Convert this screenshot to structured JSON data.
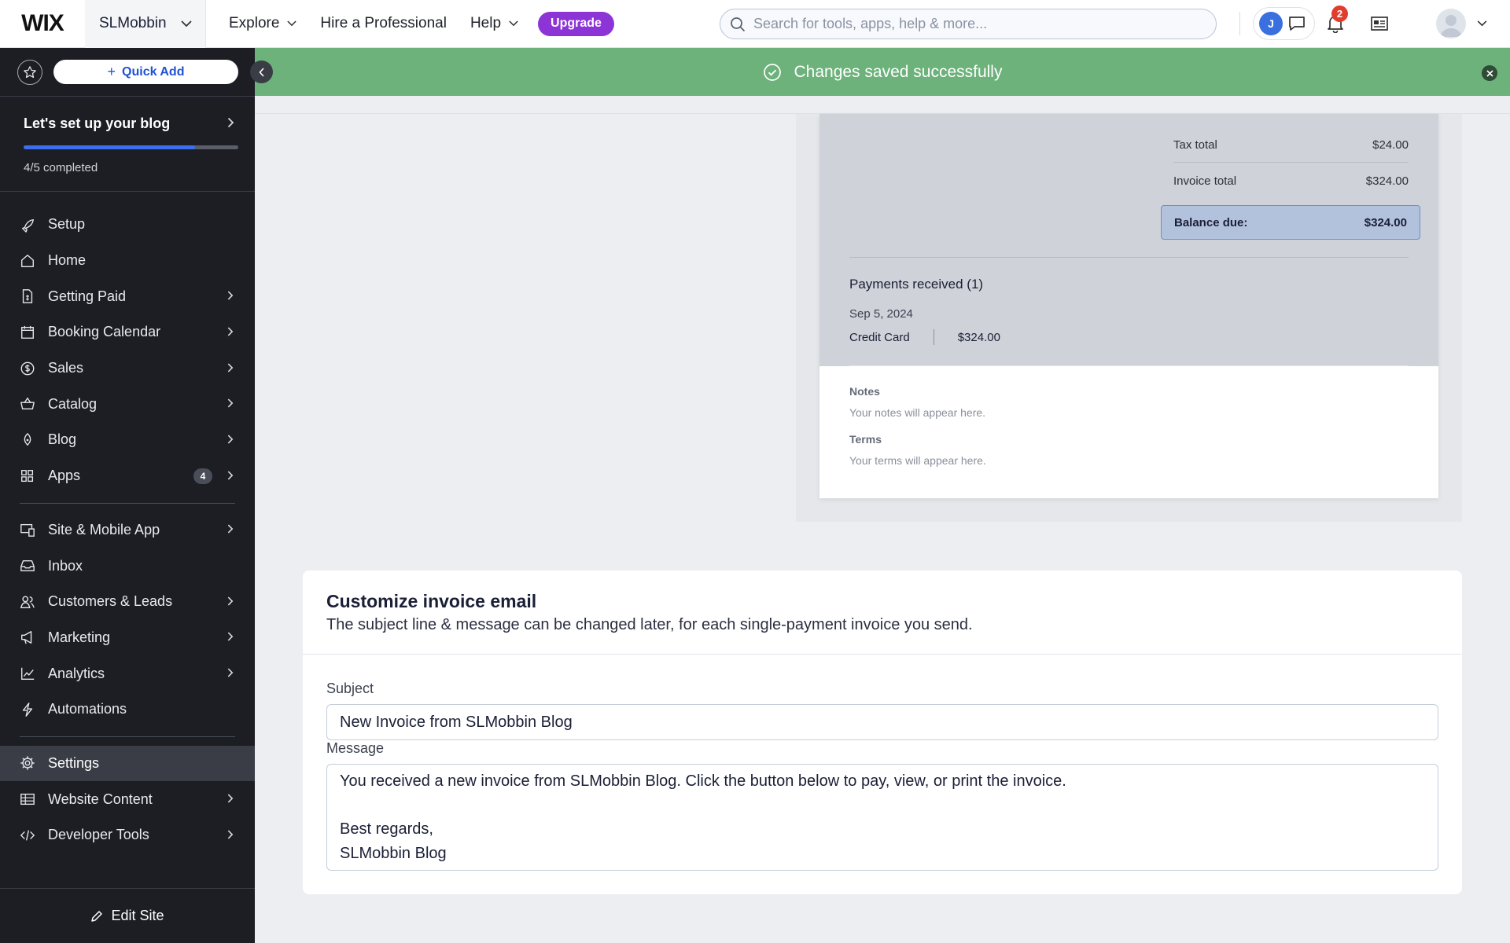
{
  "topbar": {
    "logo": "WIX",
    "site_name": "SLMobbin",
    "nav": [
      "Explore",
      "Hire a Professional",
      "Help"
    ],
    "upgrade_label": "Upgrade",
    "search_placeholder": "Search for tools, apps, help & more...",
    "chat_avatar_initial": "J",
    "notification_count": "2",
    "accent_color": "#8c34d6"
  },
  "toast": {
    "message": "Changes saved successfully",
    "color": "#6cb27a"
  },
  "sidebar": {
    "quick_add_label": "Quick Add",
    "setup": {
      "title": "Let's set up your blog",
      "progress_text": "4/5 completed",
      "progress_fraction": 0.8
    },
    "items": [
      {
        "label": "Setup",
        "icon": "rocket-icon",
        "chevron": false
      },
      {
        "label": "Home",
        "icon": "home-icon",
        "chevron": false
      },
      {
        "label": "Getting Paid",
        "icon": "document-dollar-icon",
        "chevron": true
      },
      {
        "label": "Booking Calendar",
        "icon": "calendar-icon",
        "chevron": true
      },
      {
        "label": "Sales",
        "icon": "dollar-circle-icon",
        "chevron": true
      },
      {
        "label": "Catalog",
        "icon": "basket-icon",
        "chevron": true
      },
      {
        "label": "Blog",
        "icon": "pen-nib-icon",
        "chevron": true
      },
      {
        "label": "Apps",
        "icon": "apps-grid-icon",
        "chevron": true,
        "badge": "4"
      },
      {
        "label": "Site & Mobile App",
        "icon": "devices-icon",
        "chevron": true
      },
      {
        "label": "Inbox",
        "icon": "inbox-icon",
        "chevron": false
      },
      {
        "label": "Customers & Leads",
        "icon": "people-icon",
        "chevron": true
      },
      {
        "label": "Marketing",
        "icon": "megaphone-icon",
        "chevron": true
      },
      {
        "label": "Analytics",
        "icon": "chart-line-icon",
        "chevron": true
      },
      {
        "label": "Automations",
        "icon": "lightning-icon",
        "chevron": false
      },
      {
        "label": "Settings",
        "icon": "gear-icon",
        "chevron": false,
        "active": true
      },
      {
        "label": "Website Content",
        "icon": "table-icon",
        "chevron": true
      },
      {
        "label": "Developer Tools",
        "icon": "code-icon",
        "chevron": true
      }
    ],
    "edit_site_label": "Edit Site"
  },
  "invoice_preview": {
    "tax_total_label": "Tax total",
    "tax_total_value": "$24.00",
    "invoice_total_label": "Invoice total",
    "invoice_total_value": "$324.00",
    "balance_due_label": "Balance due:",
    "balance_due_value": "$324.00",
    "payments_title": "Payments received (1)",
    "payment_date": "Sep 5, 2024",
    "payment_method": "Credit Card",
    "payment_amount": "$324.00",
    "notes_label": "Notes",
    "notes_text": "Your notes will appear here.",
    "terms_label": "Terms",
    "terms_text": "Your terms will appear here."
  },
  "email_card": {
    "title": "Customize invoice email",
    "subtitle": "The subject line & message can be changed later, for each single-payment invoice you send.",
    "subject_label": "Subject",
    "subject_value": "New Invoice from SLMobbin Blog",
    "message_label": "Message",
    "message_value": "You received a new invoice from SLMobbin Blog. Click the button below to pay, view, or print the invoice.\n\nBest regards,\nSLMobbin Blog"
  }
}
